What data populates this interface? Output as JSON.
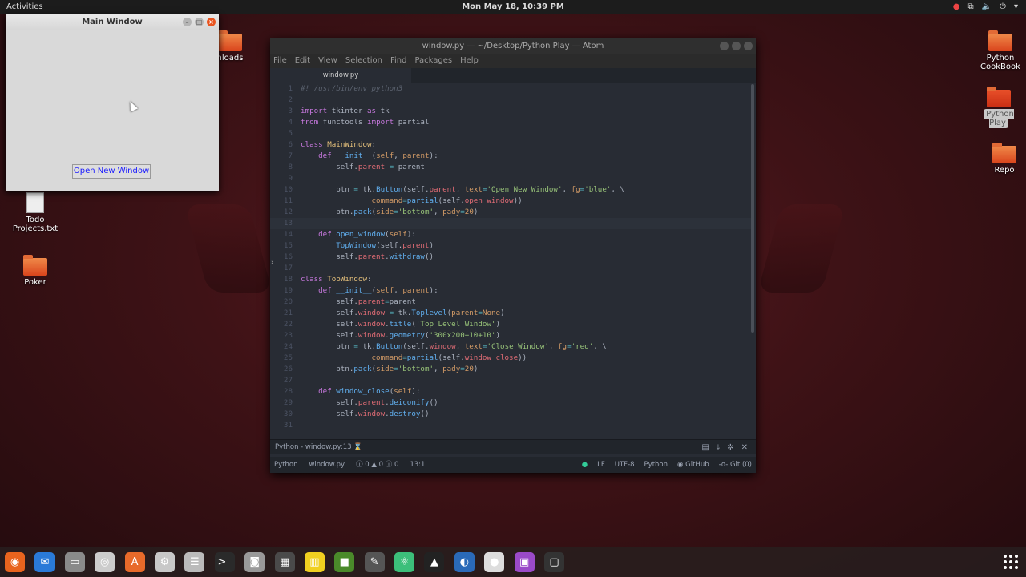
{
  "topbar": {
    "activities": "Activities",
    "clock": "Mon May 18, 10:39 PM",
    "tray": [
      "camera-icon",
      "network-icon",
      "volume-icon",
      "power-icon",
      "menu-icon"
    ]
  },
  "desktop": {
    "icons": [
      {
        "label": "nloads"
      },
      {
        "label": "Todo Projects.txt"
      },
      {
        "label": "Poker"
      },
      {
        "label": "Python CookBook"
      },
      {
        "label": "Python Play"
      },
      {
        "label": "Repo"
      }
    ]
  },
  "main_window": {
    "title": "Main Window",
    "button": "Open New Window"
  },
  "atom": {
    "title": "window.py — ~/Desktop/Python Play — Atom",
    "menu": [
      "File",
      "Edit",
      "View",
      "Selection",
      "Find",
      "Packages",
      "Help"
    ],
    "tab": "window.py",
    "lines": [
      {
        "n": "1",
        "t": [
          [
            "#! /usr/bin/env python3",
            "m"
          ]
        ]
      },
      {
        "n": "2",
        "t": []
      },
      {
        "n": "3",
        "t": [
          [
            "import",
            "k"
          ],
          [
            " tkinter ",
            ""
          ],
          [
            "as",
            "k"
          ],
          [
            " tk",
            ""
          ]
        ]
      },
      {
        "n": "4",
        "t": [
          [
            "from",
            "k"
          ],
          [
            " functools ",
            ""
          ],
          [
            "import",
            "k"
          ],
          [
            " partial",
            ""
          ]
        ]
      },
      {
        "n": "5",
        "t": []
      },
      {
        "n": "6",
        "t": [
          [
            "class",
            "k"
          ],
          [
            " ",
            ""
          ],
          [
            "MainWindow",
            "c"
          ],
          [
            ":",
            ""
          ]
        ]
      },
      {
        "n": "7",
        "t": [
          [
            "    ",
            ""
          ],
          [
            "def",
            "k"
          ],
          [
            " ",
            ""
          ],
          [
            "__init__",
            "f"
          ],
          [
            "(",
            ""
          ],
          [
            "self",
            "o"
          ],
          [
            ", ",
            ""
          ],
          [
            "parent",
            "o"
          ],
          [
            "):",
            ""
          ]
        ]
      },
      {
        "n": "8",
        "t": [
          [
            "        self.",
            ""
          ],
          [
            "parent",
            "p"
          ],
          [
            " ",
            ""
          ],
          [
            "=",
            "x"
          ],
          [
            " parent",
            ""
          ]
        ]
      },
      {
        "n": "9",
        "t": []
      },
      {
        "n": "10",
        "t": [
          [
            "        btn ",
            ""
          ],
          [
            "=",
            "x"
          ],
          [
            " tk.",
            ""
          ],
          [
            "Button",
            "f"
          ],
          [
            "(self.",
            ""
          ],
          [
            "parent",
            "p"
          ],
          [
            ", ",
            ""
          ],
          [
            "text",
            "o"
          ],
          [
            "=",
            "x"
          ],
          [
            "'Open New Window'",
            "s"
          ],
          [
            ", ",
            ""
          ],
          [
            "fg",
            "o"
          ],
          [
            "=",
            "x"
          ],
          [
            "'blue'",
            "s"
          ],
          [
            ", \\",
            ""
          ]
        ]
      },
      {
        "n": "11",
        "t": [
          [
            "                ",
            ""
          ],
          [
            "command",
            "o"
          ],
          [
            "=",
            "x"
          ],
          [
            "partial",
            "f"
          ],
          [
            "(self.",
            ""
          ],
          [
            "open_window",
            "p"
          ],
          [
            "))",
            ""
          ]
        ]
      },
      {
        "n": "12",
        "t": [
          [
            "        btn.",
            ""
          ],
          [
            "pack",
            "f"
          ],
          [
            "(",
            ""
          ],
          [
            "side",
            "o"
          ],
          [
            "=",
            "x"
          ],
          [
            "'bottom'",
            "s"
          ],
          [
            ", ",
            ""
          ],
          [
            "pady",
            "o"
          ],
          [
            "=",
            "x"
          ],
          [
            "20",
            "o"
          ],
          [
            ")",
            ""
          ]
        ]
      },
      {
        "n": "13",
        "t": [],
        "current": true
      },
      {
        "n": "14",
        "t": [
          [
            "    ",
            ""
          ],
          [
            "def",
            "k"
          ],
          [
            " ",
            ""
          ],
          [
            "open_window",
            "f"
          ],
          [
            "(",
            ""
          ],
          [
            "self",
            "o"
          ],
          [
            "):",
            ""
          ]
        ]
      },
      {
        "n": "15",
        "t": [
          [
            "        ",
            ""
          ],
          [
            "TopWindow",
            "f"
          ],
          [
            "(self.",
            ""
          ],
          [
            "parent",
            "p"
          ],
          [
            ")",
            ""
          ]
        ]
      },
      {
        "n": "16",
        "t": [
          [
            "        self.",
            ""
          ],
          [
            "parent",
            "p"
          ],
          [
            ".",
            ""
          ],
          [
            "withdraw",
            "f"
          ],
          [
            "()",
            ""
          ]
        ]
      },
      {
        "n": "17",
        "t": []
      },
      {
        "n": "18",
        "t": [
          [
            "class",
            "k"
          ],
          [
            " ",
            ""
          ],
          [
            "TopWindow",
            "c"
          ],
          [
            ":",
            ""
          ]
        ]
      },
      {
        "n": "19",
        "t": [
          [
            "    ",
            ""
          ],
          [
            "def",
            "k"
          ],
          [
            " ",
            ""
          ],
          [
            "__init__",
            "f"
          ],
          [
            "(",
            ""
          ],
          [
            "self",
            "o"
          ],
          [
            ", ",
            ""
          ],
          [
            "parent",
            "o"
          ],
          [
            "):",
            ""
          ]
        ]
      },
      {
        "n": "20",
        "t": [
          [
            "        self.",
            ""
          ],
          [
            "parent",
            "p"
          ],
          [
            "=",
            "x"
          ],
          [
            "parent",
            ""
          ]
        ]
      },
      {
        "n": "21",
        "t": [
          [
            "        self.",
            ""
          ],
          [
            "window",
            "p"
          ],
          [
            " ",
            ""
          ],
          [
            "=",
            "x"
          ],
          [
            " tk.",
            ""
          ],
          [
            "Toplevel",
            "f"
          ],
          [
            "(",
            ""
          ],
          [
            "parent",
            "o"
          ],
          [
            "=",
            "x"
          ],
          [
            "None",
            "o"
          ],
          [
            ")",
            ""
          ]
        ]
      },
      {
        "n": "22",
        "t": [
          [
            "        self.",
            ""
          ],
          [
            "window",
            "p"
          ],
          [
            ".",
            ""
          ],
          [
            "title",
            "f"
          ],
          [
            "(",
            ""
          ],
          [
            "'Top Level Window'",
            "s"
          ],
          [
            ")",
            ""
          ]
        ]
      },
      {
        "n": "23",
        "t": [
          [
            "        self.",
            ""
          ],
          [
            "window",
            "p"
          ],
          [
            ".",
            ""
          ],
          [
            "geometry",
            "f"
          ],
          [
            "(",
            ""
          ],
          [
            "'300x200+10+10'",
            "s"
          ],
          [
            ")",
            ""
          ]
        ]
      },
      {
        "n": "24",
        "t": [
          [
            "        btn ",
            ""
          ],
          [
            "=",
            "x"
          ],
          [
            " tk.",
            ""
          ],
          [
            "Button",
            "f"
          ],
          [
            "(self.",
            ""
          ],
          [
            "window",
            "p"
          ],
          [
            ", ",
            ""
          ],
          [
            "text",
            "o"
          ],
          [
            "=",
            "x"
          ],
          [
            "'Close Window'",
            "s"
          ],
          [
            ", ",
            ""
          ],
          [
            "fg",
            "o"
          ],
          [
            "=",
            "x"
          ],
          [
            "'red'",
            "s"
          ],
          [
            ", \\",
            ""
          ]
        ]
      },
      {
        "n": "25",
        "t": [
          [
            "                ",
            ""
          ],
          [
            "command",
            "o"
          ],
          [
            "=",
            "x"
          ],
          [
            "partial",
            "f"
          ],
          [
            "(self.",
            ""
          ],
          [
            "window_close",
            "p"
          ],
          [
            "))",
            ""
          ]
        ]
      },
      {
        "n": "26",
        "t": [
          [
            "        btn.",
            ""
          ],
          [
            "pack",
            "f"
          ],
          [
            "(",
            ""
          ],
          [
            "side",
            "o"
          ],
          [
            "=",
            "x"
          ],
          [
            "'bottom'",
            "s"
          ],
          [
            ", ",
            ""
          ],
          [
            "pady",
            "o"
          ],
          [
            "=",
            "x"
          ],
          [
            "20",
            "o"
          ],
          [
            ")",
            ""
          ]
        ]
      },
      {
        "n": "27",
        "t": []
      },
      {
        "n": "28",
        "t": [
          [
            "    ",
            ""
          ],
          [
            "def",
            "k"
          ],
          [
            " ",
            ""
          ],
          [
            "window_close",
            "f"
          ],
          [
            "(",
            ""
          ],
          [
            "self",
            "o"
          ],
          [
            "):",
            ""
          ]
        ]
      },
      {
        "n": "29",
        "t": [
          [
            "        self.",
            ""
          ],
          [
            "parent",
            "p"
          ],
          [
            ".",
            ""
          ],
          [
            "deiconify",
            "f"
          ],
          [
            "()",
            ""
          ]
        ]
      },
      {
        "n": "30",
        "t": [
          [
            "        self.",
            ""
          ],
          [
            "window",
            "p"
          ],
          [
            ".",
            ""
          ],
          [
            "destroy",
            "f"
          ],
          [
            "()",
            ""
          ]
        ]
      },
      {
        "n": "31",
        "t": []
      }
    ],
    "panel": "Python - window.py:13",
    "status": {
      "grammar": "Python",
      "file": "window.py",
      "diagnostics": "ⓘ 0 ▲ 0 ⓘ 0",
      "cursor": "13:1",
      "eol": "LF",
      "encoding": "UTF-8",
      "language": "Python",
      "github": "GitHub",
      "git": "Git (0)"
    }
  },
  "dock": {
    "apps": [
      "firefox",
      "thunderbird",
      "files",
      "rhythmbox",
      "software",
      "settings",
      "tweaks",
      "terminal",
      "camera",
      "calculator",
      "ruler",
      "minecraft",
      "gimp",
      "atom",
      "inkscape",
      "vpn",
      "blender",
      "video",
      "screenshot"
    ]
  }
}
